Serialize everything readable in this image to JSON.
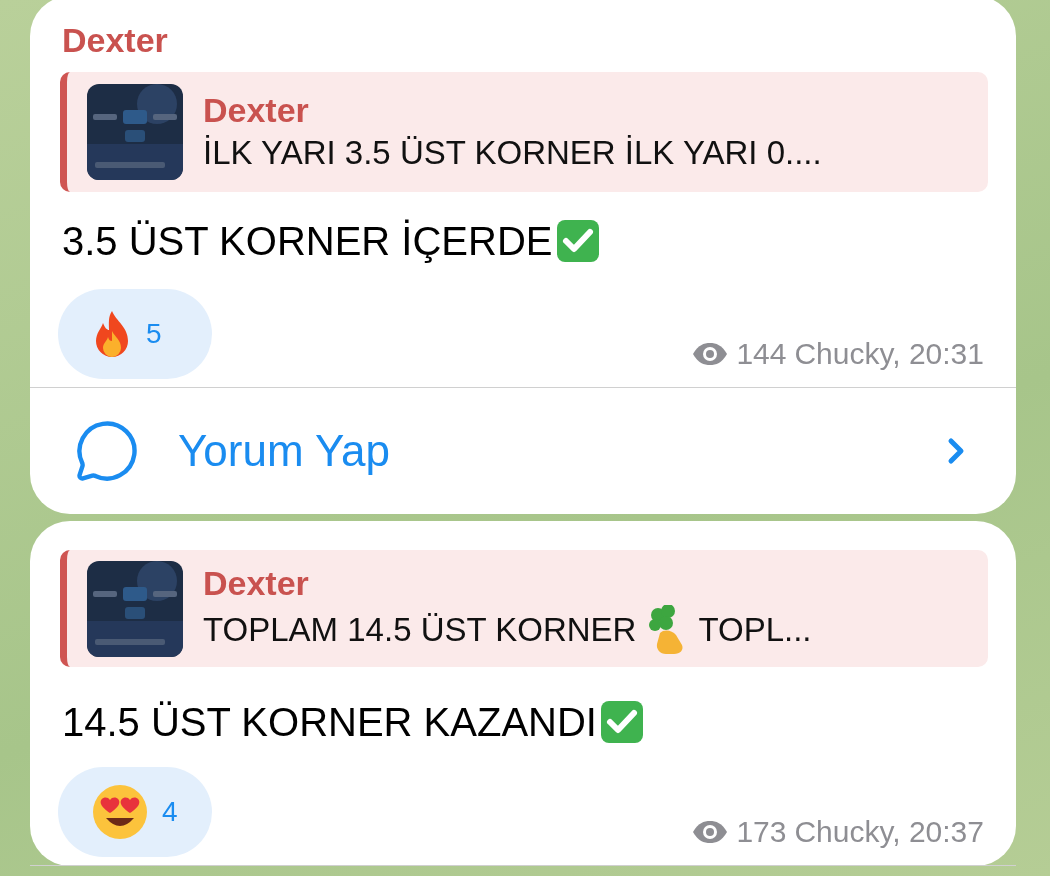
{
  "messages": [
    {
      "sender": "Dexter",
      "quote": {
        "sender": "Dexter",
        "parts": [
          {
            "kind": "text",
            "text": "İLK YARI 3.5 ÜST KORNER İLK YARI 0...."
          }
        ]
      },
      "text": "3.5 ÜST KORNER İÇERDE",
      "check": true,
      "reaction": {
        "kind": "fire",
        "count": "5"
      },
      "views": "144",
      "author": "Chucky, 20:31",
      "comment": {
        "label": "Yorum Yap"
      }
    },
    {
      "quote": {
        "sender": "Dexter",
        "parts": [
          {
            "kind": "text",
            "text": "TOPLAM 14.5 ÜST KORNER"
          },
          {
            "kind": "icon"
          },
          {
            "kind": "text",
            "text": "TOPL..."
          }
        ]
      },
      "text": "14.5 ÜST KORNER KAZANDI",
      "check": true,
      "reaction": {
        "kind": "heart-eyes",
        "count": "4"
      },
      "views": "173",
      "author": "Chucky, 20:37"
    }
  ]
}
